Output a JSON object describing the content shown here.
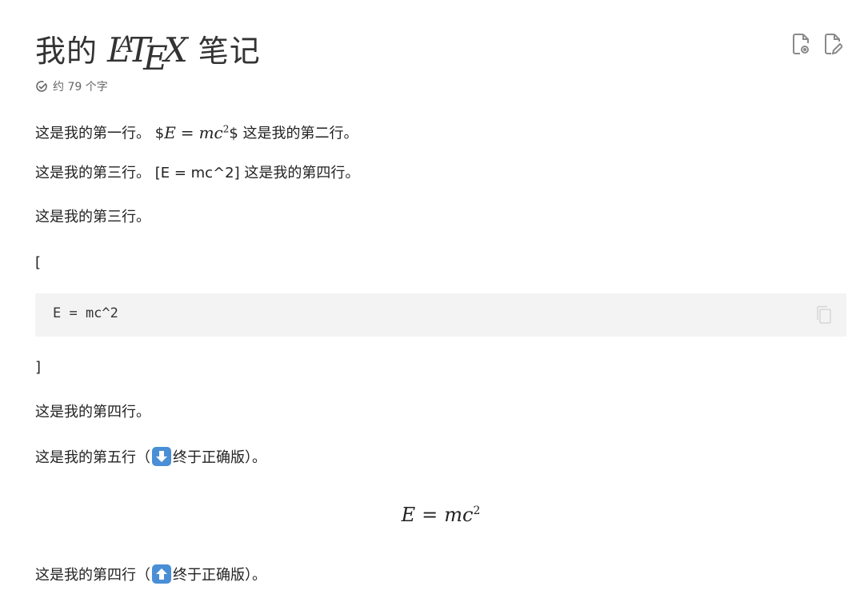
{
  "title": {
    "prefix": "我的",
    "logo_text": "LaTeX",
    "suffix": "笔记"
  },
  "actions": {
    "preview_icon": "file-preview-icon",
    "edit_icon": "file-edit-icon"
  },
  "meta": {
    "word_count_label": "约 79 个字",
    "icon": "check-circle-icon"
  },
  "paragraphs": {
    "p1_before": "这是我的第一行。 $",
    "p1_math": "E = mc²",
    "p1_after": "$ 这是我的第二行。",
    "p2": "这是我的第三行。 [E = mc^2] 这是我的第四行。",
    "p3": "这是我的第三行。",
    "open_bracket": "[",
    "close_bracket": "]",
    "p4": "这是我的第四行。",
    "p5_before": "这是我的第五行（",
    "p5_after": "终于正确版）。",
    "p6_before": "这是我的第四行（",
    "p6_after": "终于正确版）。"
  },
  "code_block": {
    "text": "E = mc^2",
    "copy_icon": "copy-icon"
  },
  "display_math": {
    "lhs": "E",
    "eq": "=",
    "rhs": "mc",
    "exp": "2"
  },
  "colors": {
    "code_bg": "#f3f3f3",
    "emoji_blue": "#4a8fd6",
    "text": "#222222",
    "muted": "#666666"
  }
}
